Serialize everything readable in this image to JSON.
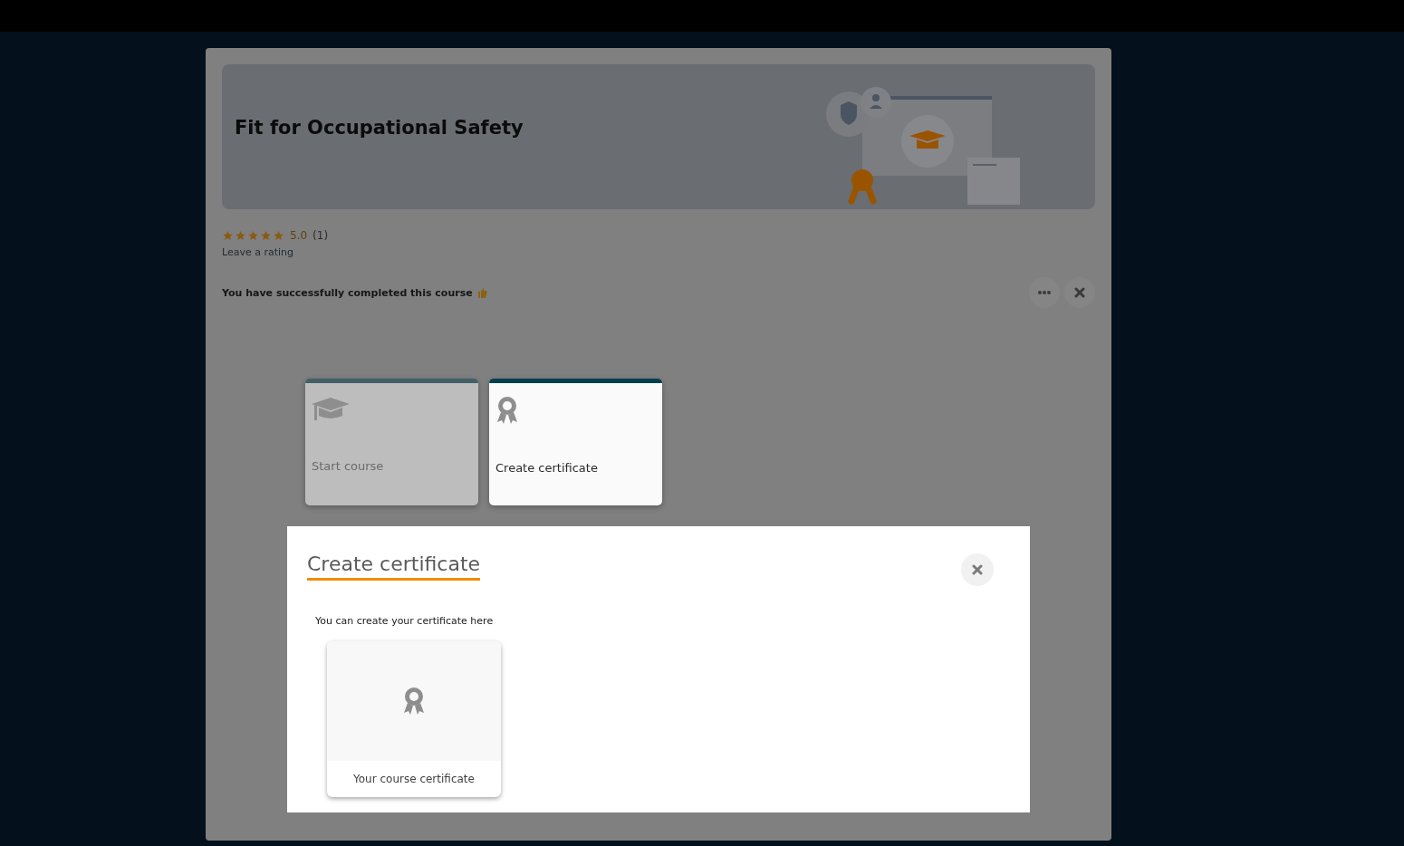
{
  "course": {
    "title": "Fit for Occupational Safety",
    "stars": 5,
    "rating": "5.0",
    "rating_count": "(1)",
    "rate_link": "Leave a rating",
    "status_message": "You have successfully completed this course"
  },
  "tiles": [
    {
      "label": "Start course",
      "kind": "course",
      "disabled": true
    },
    {
      "label": "Create certificate",
      "kind": "certificate",
      "disabled": false
    }
  ],
  "dialog": {
    "title": "Create certificate",
    "description": "You can create your certificate here",
    "cards": [
      {
        "label": "Your course certificate"
      }
    ]
  }
}
